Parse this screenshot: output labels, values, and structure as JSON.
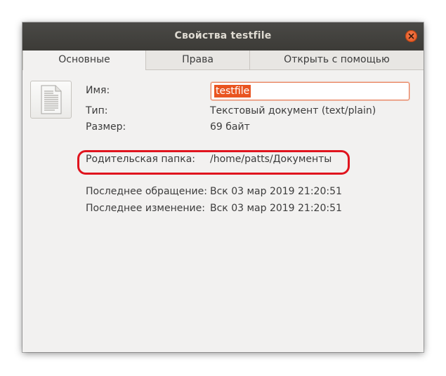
{
  "window": {
    "title": "Свойства testfile"
  },
  "tabs": [
    {
      "label": "Основные",
      "active": true
    },
    {
      "label": "Права",
      "active": false
    },
    {
      "label": "Открыть с помощью",
      "active": false
    }
  ],
  "file": {
    "icon": "text-document-icon"
  },
  "fields": {
    "name_label": "Имя:",
    "name_value": "testfile",
    "type_label": "Тип:",
    "type_value": "Текстовый документ (text/plain)",
    "size_label": "Размер:",
    "size_value": "69 байт",
    "parent_label": "Родительская папка:",
    "parent_value": "/home/patts/Документы",
    "accessed_label": "Последнее обращение:",
    "accessed_value": "Вск 03 мар 2019 21:20:51",
    "modified_label": "Последнее изменение:",
    "modified_value": "Вск 03 мар 2019 21:20:51"
  },
  "colors": {
    "titlebar": "#3c3b37",
    "accent": "#e95420",
    "highlight": "#e0141e",
    "background": "#f2f1f0"
  }
}
